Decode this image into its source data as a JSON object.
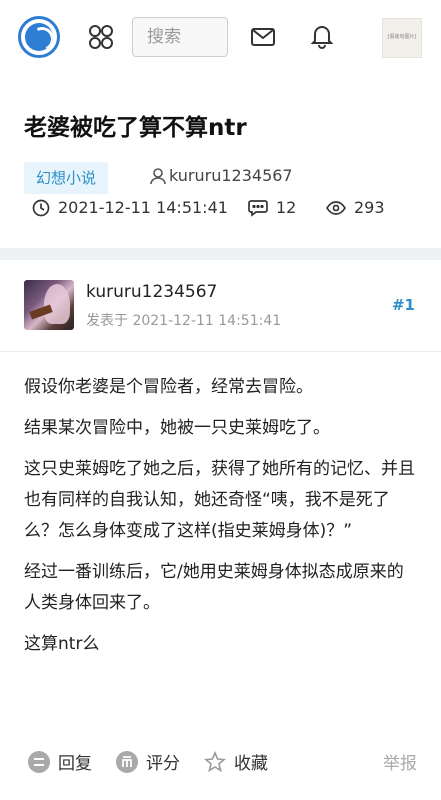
{
  "header": {
    "search_placeholder": "搜索",
    "avatar_text": "[假装有图片]"
  },
  "post": {
    "title": "老婆被吃了算不算ntr",
    "category": "幻想小说",
    "author": "kururu1234567",
    "datetime": "2021-12-11 14:51:41",
    "comments": "12",
    "views": "293"
  },
  "reply": {
    "username": "kururu1234567",
    "posted_at": "发表于 2021-12-11 14:51:41",
    "floor": "#1",
    "paragraphs": [
      "假设你老婆是个冒险者，经常去冒险。",
      "结果某次冒险中，她被一只史莱姆吃了。",
      "这只史莱姆吃了她之后，获得了她所有的记忆、并且也有同样的自我认知，她还奇怪“咦，我不是死了么？怎么身体变成了这样(指史莱姆身体)？”",
      "经过一番训练后，它/她用史莱姆身体拟态成原来的人类身体回来了。",
      "这算ntr么"
    ]
  },
  "footer": {
    "reply_label": "回复",
    "rate_label": "评分",
    "favorite_label": "收藏",
    "report_label": "举报"
  },
  "colors": {
    "accent": "#2a8fc7",
    "tag_bg": "#e7f4fb",
    "band": "#edf1f4"
  }
}
